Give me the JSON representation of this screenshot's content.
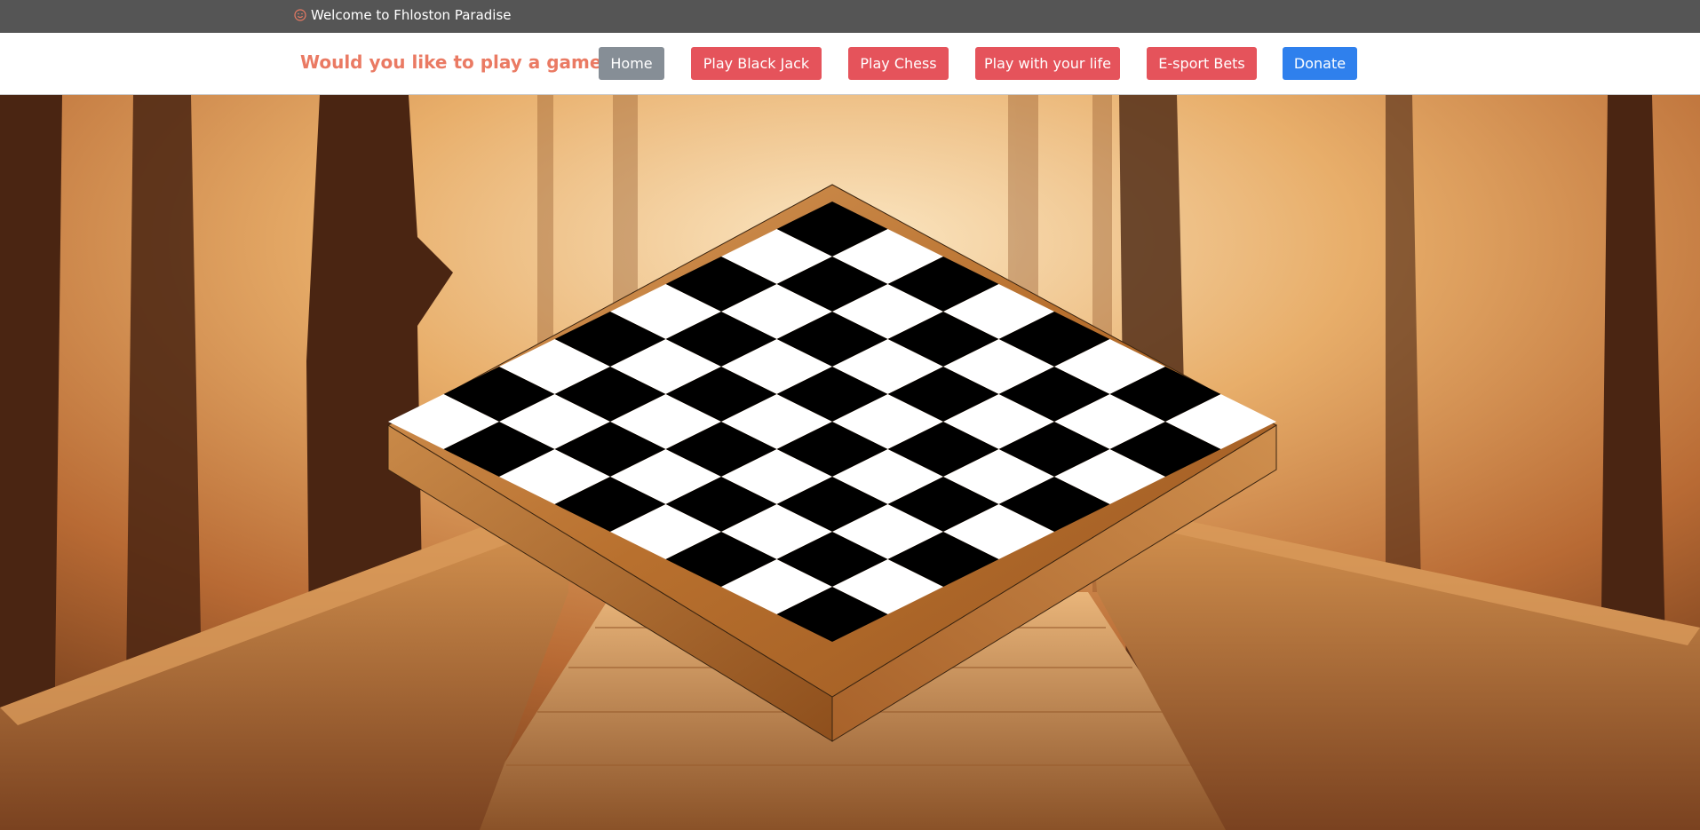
{
  "topbar": {
    "icon": "smile-icon",
    "welcome_text": "Welcome to Fhloston Paradise"
  },
  "navbar": {
    "brand": "Would you like to play a game?",
    "buttons": [
      {
        "label": "Home",
        "color": "#868e96"
      },
      {
        "label": "Play Black Jack",
        "color": "#e5535b"
      },
      {
        "label": "Play Chess",
        "color": "#e5535b"
      },
      {
        "label": "Play with your life",
        "color": "#e5535b"
      },
      {
        "label": "E-sport Bets",
        "color": "#e5535b"
      },
      {
        "label": "Donate",
        "color": "#2f80ed"
      }
    ]
  },
  "chessboard": {
    "rows": 8,
    "cols": 8,
    "dark_square_color": "#000000",
    "light_square_color": "#ffffff",
    "board_wood_color": "#b8702e"
  },
  "colors": {
    "brand_accent": "#ea7a63",
    "topbar_bg": "#555555"
  }
}
